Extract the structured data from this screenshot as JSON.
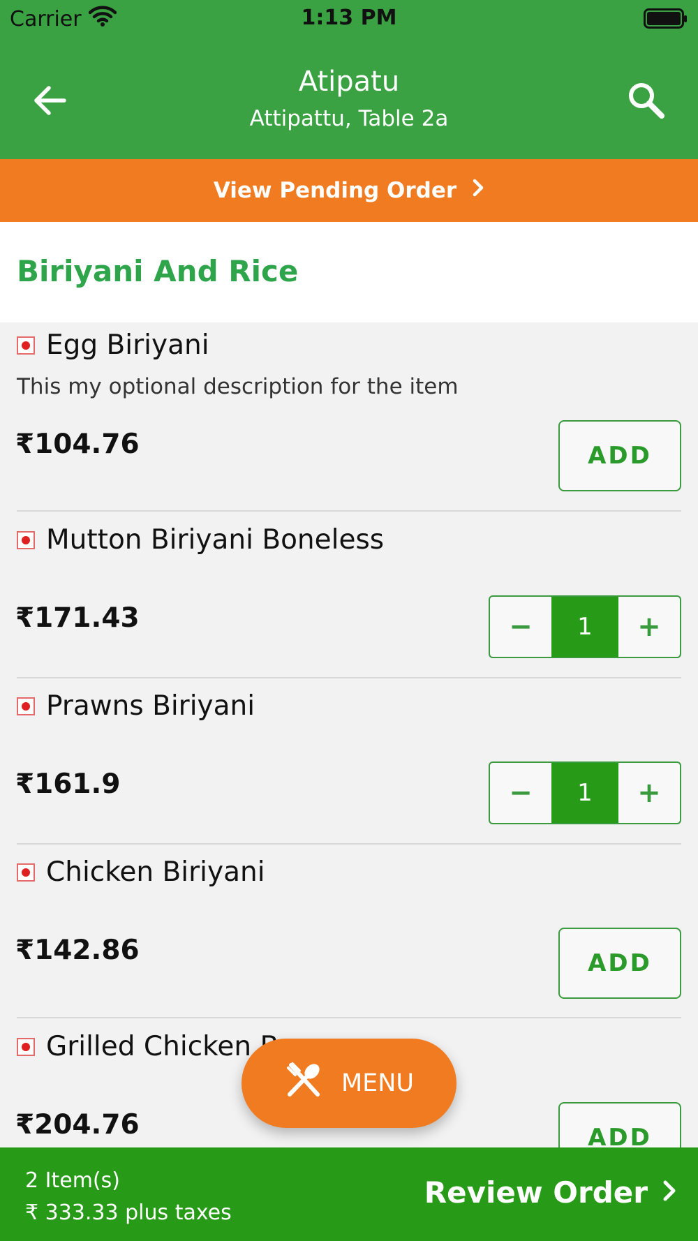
{
  "status": {
    "carrier": "Carrier",
    "time": "1:13 PM"
  },
  "header": {
    "title": "Atipatu",
    "subtitle": "Attipattu, Table 2a"
  },
  "pending_order": {
    "label": "View Pending Order"
  },
  "section": {
    "title": "Biriyani And Rice"
  },
  "items": [
    {
      "name": "Egg Biriyani",
      "description": "This my optional description for the item",
      "price": "₹104.76",
      "add_label": "ADD"
    },
    {
      "name": "Mutton Biriyani Boneless",
      "price": "₹171.43",
      "minus": "−",
      "quantity": "1",
      "plus": "+"
    },
    {
      "name": "Prawns Biriyani",
      "price": "₹161.9",
      "minus": "−",
      "quantity": "1",
      "plus": "+"
    },
    {
      "name": "Chicken Biriyani",
      "price": "₹142.86",
      "add_label": "ADD"
    },
    {
      "name": "Grilled Chicken B",
      "price": "₹204.76",
      "add_label": "ADD"
    }
  ],
  "menu_button": {
    "label": "MENU"
  },
  "footer": {
    "items_count": "2 Item(s)",
    "total": "₹ 333.33 plus taxes",
    "review_label": "Review Order"
  },
  "colors": {
    "header_green": "#3aa242",
    "accent_orange": "#f07b21",
    "action_green": "#279a17",
    "section_title_green": "#2ea44b"
  }
}
